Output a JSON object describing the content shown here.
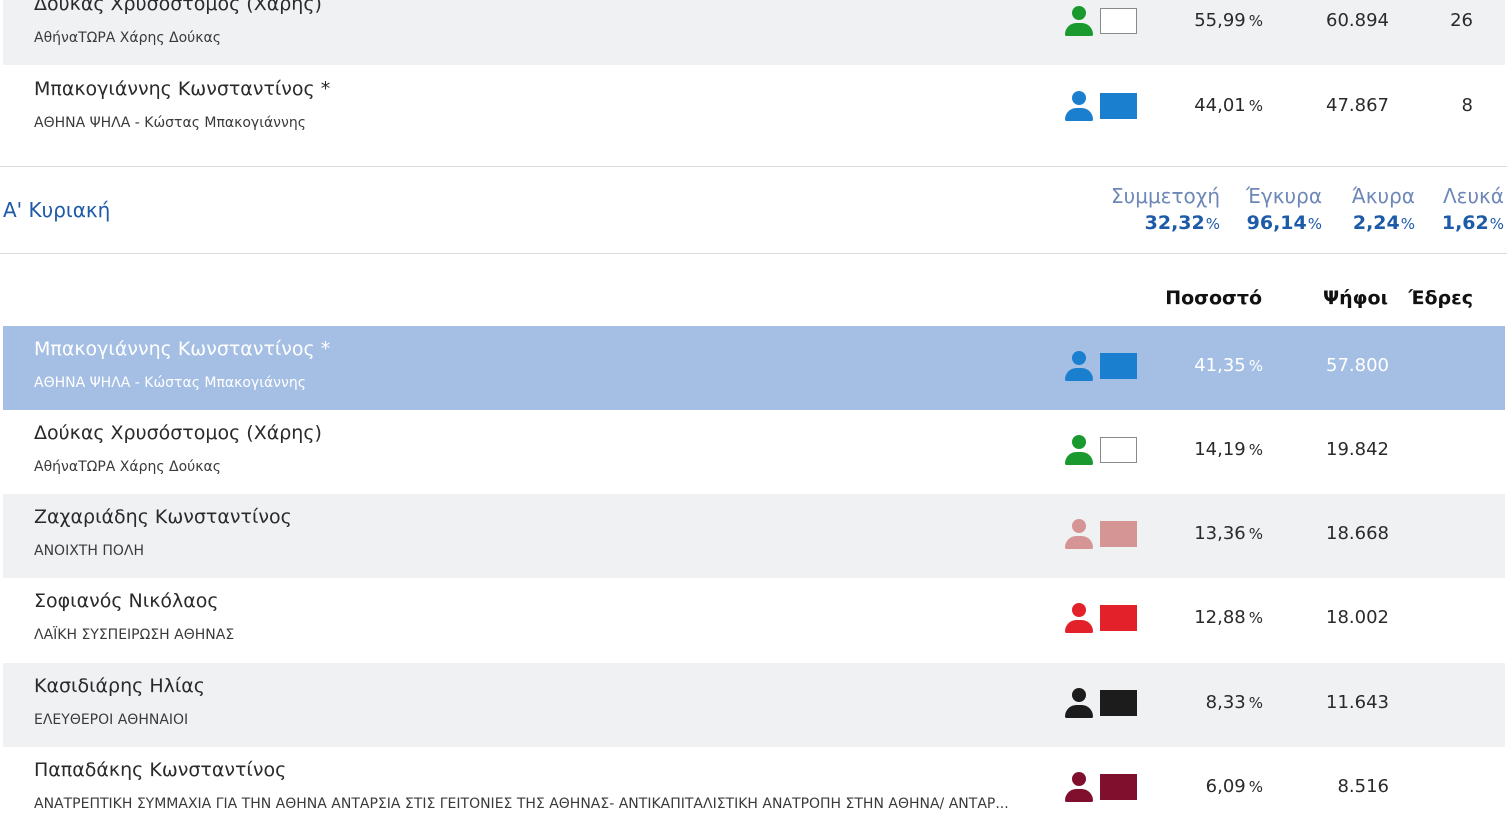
{
  "prev_round": {
    "rows": [
      {
        "name": "Δούκας Χρυσόστομος (Χάρης)",
        "party": "ΑθήναΤΩΡΑ Χάρης Δούκας",
        "color": "#1a9a2e",
        "percent": "55,99",
        "votes": "60.894",
        "seats": "26"
      },
      {
        "name": "Μπακογιάννης Κωνσταντίνος *",
        "party": "ΑΘΗΝΑ ΨΗΛΑ - Κώστας Μπακογιάννης",
        "color": "#1b7fd0",
        "percent": "44,01",
        "votes": "47.867",
        "seats": "8"
      }
    ]
  },
  "round": {
    "title": "Α' Κυριακή",
    "stats": {
      "turnout_label": "Συμμετοχή",
      "turnout": "32,32",
      "valid_label": "Έγκυρα",
      "valid": "96,14",
      "invalid_label": "Άκυρα",
      "invalid": "2,24",
      "blank_label": "Λευκά",
      "blank": "1,62",
      "pct_sign": "%"
    },
    "columns": {
      "percent": "Ποσοστό",
      "votes": "Ψήφοι",
      "seats": "Έδρες"
    },
    "rows": [
      {
        "name": "Μπακογιάννης Κωνσταντίνος *",
        "party": "ΑΘΗΝΑ ΨΗΛΑ - Κώστας Μπακογιάννης",
        "color": "#1b7fd0",
        "percent": "41,35",
        "votes": "57.800"
      },
      {
        "name": "Δούκας Χρυσόστομος (Χάρης)",
        "party": "ΑθήναΤΩΡΑ Χάρης Δούκας",
        "color": "#1a9a2e",
        "percent": "14,19",
        "votes": "19.842"
      },
      {
        "name": "Ζαχαριάδης Κωνσταντίνος",
        "party": "ΑΝΟΙΧΤΗ ΠΟΛΗ",
        "color": "#d49594",
        "percent": "13,36",
        "votes": "18.668"
      },
      {
        "name": "Σοφιανός Νικόλαος",
        "party": "ΛΑΪΚΗ ΣΥΣΠΕΙΡΩΣΗ ΑΘΗΝΑΣ",
        "color": "#e2212b",
        "percent": "12,88",
        "votes": "18.002"
      },
      {
        "name": "Κασιδιάρης Ηλίας",
        "party": "ΕΛΕΥΘΕΡΟΙ ΑΘΗΝΑΙΟΙ",
        "color": "#1c1c1c",
        "percent": "8,33",
        "votes": "11.643"
      },
      {
        "name": "Παπαδάκης Κωνσταντίνος",
        "party": "ΑΝΑΤΡΕΠΤΙΚΗ ΣΥΜΜΑΧΙΑ ΓΙΑ ΤΗΝ ΑΘΗΝΑ ΑΝΤΑΡΣΙΑ ΣΤΙΣ ΓΕΙΤΟΝΙΕΣ ΤΗΣ ΑΘΗΝΑΣ- ΑΝΤΙΚΑΠΙΤΑΛΙΣΤΙΚΗ ΑΝΑΤΡΟΠΗ ΣΤΗΝ ΑΘΗΝΑ/ ΑΝΤΑΡ...",
        "color": "#7f0f2d",
        "percent": "6,09",
        "votes": "8.516"
      }
    ]
  },
  "unit_percent": "%",
  "icons": {
    "candidate": "person-icon",
    "party_color": "color-swatch"
  }
}
